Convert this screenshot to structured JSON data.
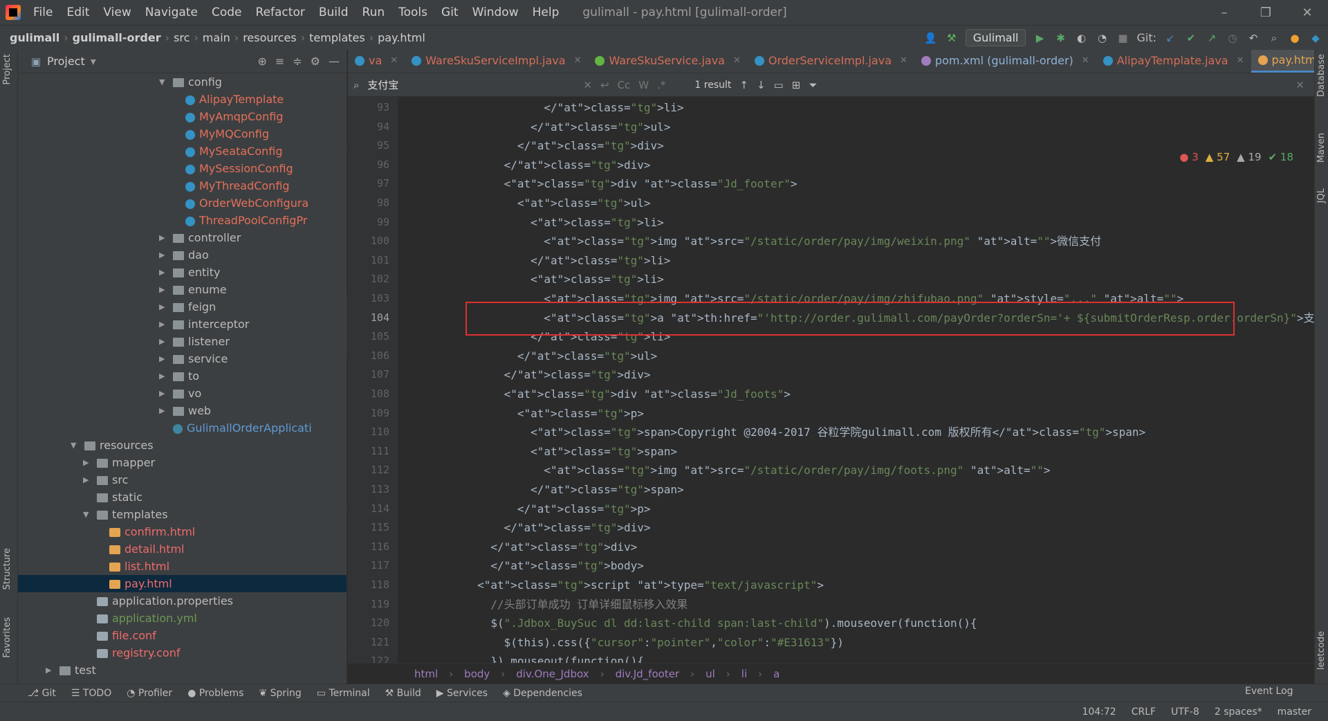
{
  "menubar": {
    "items": [
      "File",
      "Edit",
      "View",
      "Navigate",
      "Code",
      "Refactor",
      "Build",
      "Run",
      "Tools",
      "Git",
      "Window",
      "Help"
    ],
    "title": "gulimall - pay.html [gulimall-order]"
  },
  "navbar": {
    "crumbs": [
      "gulimall",
      "gulimall-order",
      "src",
      "main",
      "resources",
      "templates",
      "pay.html"
    ],
    "run_config": "Gulimall",
    "git_label": "Git:"
  },
  "project": {
    "title": "Project",
    "nodes": [
      {
        "label": "config",
        "kind": "folder",
        "indent": 1,
        "open": true
      },
      {
        "label": "AlipayTemplate",
        "kind": "class",
        "indent": 2,
        "color": "orange"
      },
      {
        "label": "MyAmqpConfig",
        "kind": "class",
        "indent": 2,
        "color": "orange"
      },
      {
        "label": "MyMQConfig",
        "kind": "class",
        "indent": 2,
        "color": "orange"
      },
      {
        "label": "MySeataConfig",
        "kind": "class",
        "indent": 2,
        "color": "orange"
      },
      {
        "label": "MySessionConfig",
        "kind": "class",
        "indent": 2,
        "color": "orange"
      },
      {
        "label": "MyThreadConfig",
        "kind": "class",
        "indent": 2,
        "color": "orange"
      },
      {
        "label": "OrderWebConfigura",
        "kind": "class",
        "indent": 2,
        "color": "orange"
      },
      {
        "label": "ThreadPoolConfigPr",
        "kind": "class",
        "indent": 2,
        "color": "orange"
      },
      {
        "label": "controller",
        "kind": "folder",
        "indent": 1
      },
      {
        "label": "dao",
        "kind": "folder",
        "indent": 1
      },
      {
        "label": "entity",
        "kind": "folder",
        "indent": 1
      },
      {
        "label": "enume",
        "kind": "folder",
        "indent": 1
      },
      {
        "label": "feign",
        "kind": "folder",
        "indent": 1
      },
      {
        "label": "interceptor",
        "kind": "folder",
        "indent": 1
      },
      {
        "label": "listener",
        "kind": "folder",
        "indent": 1
      },
      {
        "label": "service",
        "kind": "folder",
        "indent": 1
      },
      {
        "label": "to",
        "kind": "folder",
        "indent": 1
      },
      {
        "label": "vo",
        "kind": "folder",
        "indent": 1
      },
      {
        "label": "web",
        "kind": "folder",
        "indent": 1
      },
      {
        "label": "GulimallOrderApplicati",
        "kind": "class",
        "indent": 1,
        "color": "blue"
      },
      {
        "label": "resources",
        "kind": "folder",
        "indent": 0,
        "open": true
      },
      {
        "label": "mapper",
        "kind": "folder",
        "indent": 1
      },
      {
        "label": "src",
        "kind": "folder",
        "indent": 1
      },
      {
        "label": "static",
        "kind": "folder",
        "indent": 1,
        "leaf": true
      },
      {
        "label": "templates",
        "kind": "folder",
        "indent": 1,
        "open": true
      },
      {
        "label": "confirm.html",
        "kind": "html",
        "indent": 2,
        "color": "red"
      },
      {
        "label": "detail.html",
        "kind": "html",
        "indent": 2,
        "color": "red"
      },
      {
        "label": "list.html",
        "kind": "html",
        "indent": 2,
        "color": "red"
      },
      {
        "label": "pay.html",
        "kind": "html",
        "indent": 2,
        "color": "red",
        "selected": true
      },
      {
        "label": "application.properties",
        "kind": "prop",
        "indent": 1
      },
      {
        "label": "application.yml",
        "kind": "prop",
        "indent": 1,
        "color": "green"
      },
      {
        "label": "file.conf",
        "kind": "prop",
        "indent": 1,
        "color": "red"
      },
      {
        "label": "registry.conf",
        "kind": "prop",
        "indent": 1,
        "color": "red"
      },
      {
        "label": "test",
        "kind": "folder",
        "indent": -1
      }
    ]
  },
  "tabs": [
    {
      "label": "va",
      "color": "#3592c4"
    },
    {
      "label": "WareSkuServiceImpl.java",
      "color": "#3592c4"
    },
    {
      "label": "WareSkuService.java",
      "color": "#62b543"
    },
    {
      "label": "OrderServiceImpl.java",
      "color": "#3592c4"
    },
    {
      "label": "pom.xml (gulimall-order)",
      "color": "#a07cc0"
    },
    {
      "label": "AlipayTemplate.java",
      "color": "#3592c4"
    },
    {
      "label": "pay.html",
      "color": "#e4a451",
      "active": true
    }
  ],
  "search": {
    "query": "支付宝",
    "result": "1 result"
  },
  "inspections": {
    "errors": "3",
    "warnings": "57",
    "weak": "19",
    "ok": "18"
  },
  "code": {
    "first_line": 93,
    "current_line": 104,
    "lines": [
      "                  </li>",
      "                </ul>",
      "              </div>",
      "            </div>",
      "            <div class=\"Jd_footer\">",
      "              <ul>",
      "                <li>",
      "                  <img src=\"/static/order/pay/img/weixin.png\" alt=\"\">微信支付",
      "                </li>",
      "                <li>",
      "                  <img src=\"/static/order/pay/img/zhifubao.png\" style=\"...\" alt=\"\">",
      "                  <a th:href=\"'http://order.gulimall.com/payOrder?orderSn='+ ${submitOrderResp.order.orderSn}\">支付宝</a>",
      "                </li>",
      "              </ul>",
      "            </div>",
      "            <div class=\"Jd_foots\">",
      "              <p>",
      "                <span>Copyright @2004-2017 谷粒学院gulimall.com 版权所有</span>",
      "                <span>",
      "                  <img src=\"/static/order/pay/img/foots.png\" alt=\"\">",
      "                </span>",
      "              </p>",
      "            </div>",
      "          </div>",
      "          </body>",
      "        <script type=\"text/javascript\">",
      "          //头部订单成功 订单详细鼠标移入效果",
      "          $(\".Jdbox_BuySuc dl dd:last-child span:last-child\").mouseover(function(){",
      "            $(this).css({\"cursor\":\"pointer\",\"color\":\"#E31613\"})",
      "          }).mouseout(function(){"
    ]
  },
  "breadcrumb": [
    "html",
    "body",
    "div.One_Jdbox",
    "div.Jd_footer",
    "ul",
    "li",
    "a"
  ],
  "bottom_tools": [
    "Git",
    "TODO",
    "Profiler",
    "Problems",
    "Spring",
    "Terminal",
    "Build",
    "Services",
    "Dependencies"
  ],
  "event_log": "Event Log",
  "status": {
    "position": "104:72",
    "line_sep": "CRLF",
    "encoding": "UTF-8",
    "indent": "2 spaces*",
    "branch": "master"
  },
  "side": {
    "left": [
      "Project",
      "Structure",
      "Favorites"
    ],
    "right": [
      "Database",
      "Maven",
      "JQL",
      "leetcode"
    ]
  }
}
